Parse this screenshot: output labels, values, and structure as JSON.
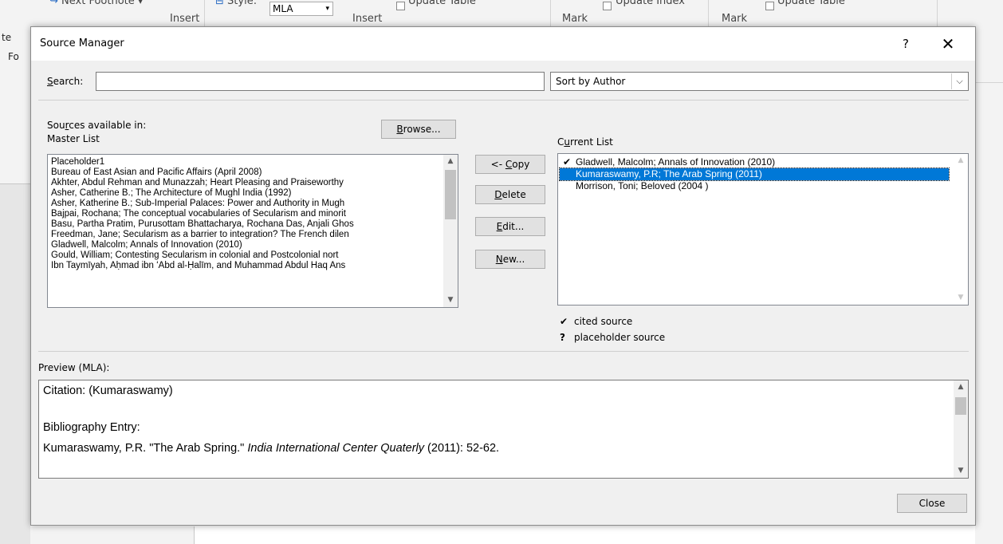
{
  "ribbon": {
    "next_footnote": "Next Footnote",
    "insert_1": "Insert",
    "style_label": "Style:",
    "style_value": "MLA",
    "insert_2": "Insert",
    "update_table_1": "Update Table",
    "mark_1": "Mark",
    "update_index": "Update Index",
    "mark_2": "Mark",
    "update_table_2": "Update Table",
    "left_fragment_1": "te",
    "left_fragment_2": "Fo"
  },
  "dialog": {
    "title": "Source Manager",
    "help": "?",
    "close_x": "✕",
    "search": {
      "label_u": "S",
      "label_rest": "earch:",
      "value": ""
    },
    "sort": {
      "value": "Sort by Author",
      "arrow": "⌵"
    },
    "sources_label": {
      "before": "Sou",
      "u": "r",
      "after": "ces available in:"
    },
    "master_list_label": "Master List",
    "browse_button": {
      "u": "B",
      "rest": "rowse..."
    },
    "current_list_label": {
      "before": "C",
      "u": "u",
      "after": "rrent List"
    },
    "master_items": [
      "Placeholder1",
      "Bureau of East Asian and Pacific Affairs  (April 2008)",
      "Akhter, Abdul Rehman and Munazzah; Heart Pleasing and Praiseworthy",
      "Asher, Catherine B.; The Architecture of Mughl India (1992)",
      "Asher, Katherine B.; Sub-Imperial Palaces: Power and Authority in Mugh",
      "Bajpai, Rochana; The conceptual vocabularies of Secularism and minorit",
      "Basu, Partha Pratim, Purusottam Bhattacharya, Rochana Das, Anjali Ghos",
      "Freedman, Jane; Secularism as a barrier to integration? The French dilen",
      "Gladwell, Malcolm; Annals of Innovation (2010)",
      "Gould, William; Contesting Secularism in colonial and Postcolonial nort",
      "Ibn Taymīyah, Aḥmad ibn ʻAbd al-Ḥalīm, and Muhammad Abdul Haq Ans"
    ],
    "buttons": {
      "copy": {
        "before": "<- ",
        "u": "C",
        "after": "opy"
      },
      "delete": {
        "u": "D",
        "rest": "elete"
      },
      "edit": {
        "u": "E",
        "rest": "dit..."
      },
      "new": {
        "u": "N",
        "rest": "ew..."
      }
    },
    "current_items": [
      {
        "text": "Gladwell, Malcolm; Annals of Innovation (2010)",
        "mark": "✔",
        "selected": false
      },
      {
        "text": "Kumaraswamy, P.R; The Arab Spring (2011)",
        "mark": "",
        "selected": true
      },
      {
        "text": "Morrison, Toni; Beloved (2004 )",
        "mark": "",
        "selected": false
      }
    ],
    "legend": [
      {
        "mark": "✔",
        "text": "cited source"
      },
      {
        "mark": "?",
        "text": "placeholder source"
      }
    ],
    "preview_label": "Preview (MLA):",
    "preview": {
      "citation": "Citation:  (Kumaraswamy)",
      "bib_heading": "Bibliography Entry:",
      "bib_before": "Kumaraswamy, P.R. \"The Arab Spring.\" ",
      "bib_italic": "India International Center Quaterly",
      "bib_after": " (2011): 52-62."
    },
    "close_button": "Close",
    "scroll_up": "▲",
    "scroll_down": "▼"
  }
}
